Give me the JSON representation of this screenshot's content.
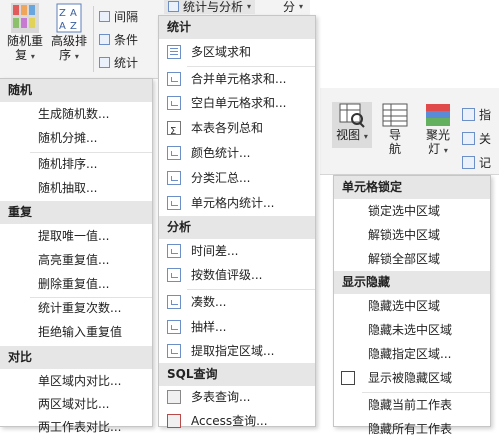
{
  "ribbon_left": {
    "random_repeat": {
      "line1": "随机重",
      "line2": "复",
      "caret": "▾"
    },
    "advanced_sort": {
      "line1": "高级排",
      "line2": "序",
      "caret": "▾"
    },
    "spacing": "间隔",
    "condition": "条件",
    "stats": "统计"
  },
  "ribbon_top": {
    "stats_analysis": "统计与分析",
    "caret": "▾",
    "split": "分"
  },
  "ribbon_right": {
    "view": "视图",
    "navigation": {
      "line1": "导",
      "line2": "航"
    },
    "spotlight": {
      "line1": "聚光",
      "line2": "灯"
    },
    "finger": "指",
    "close": "关",
    "record": "记",
    "caret": "▾"
  },
  "menu_left": {
    "sections": [
      {
        "header": "随机",
        "items": [
          "生成随机数...",
          "随机分摊...",
          "随机排序...",
          "随机抽取..."
        ]
      },
      {
        "header": "重复",
        "items": [
          "提取唯一值...",
          "高亮重复值...",
          "删除重复值...",
          "统计重复次数...",
          "拒绝输入重复值"
        ]
      },
      {
        "header": "对比",
        "items": [
          "单区域内对比...",
          "两区域对比...",
          "两工作表对比..."
        ]
      }
    ]
  },
  "menu_middle": {
    "sections": [
      {
        "header": "统计",
        "items": [
          "多区域求和",
          "合并单元格求和...",
          "空白单元格求和...",
          "本表各列总和",
          "颜色统计...",
          "分类汇总...",
          "单元格内统计..."
        ]
      },
      {
        "header": "分析",
        "items": [
          "时间差...",
          "按数值评级...",
          "凑数...",
          "抽样...",
          "提取指定区域..."
        ]
      },
      {
        "header": "SQL查询",
        "items": [
          "多表查询...",
          "Access查询..."
        ]
      }
    ]
  },
  "menu_right": {
    "sections": [
      {
        "header": "单元格锁定",
        "items": [
          "锁定选中区域",
          "解锁选中区域",
          "解锁全部区域"
        ]
      },
      {
        "header": "显示隐藏",
        "items": [
          "隐藏选中区域",
          "隐藏未选中区域",
          "隐藏指定区域...",
          "显示被隐藏区域",
          "隐藏当前工作表",
          "隐藏所有工作表"
        ]
      }
    ]
  },
  "colors": {
    "accent": "#4472c4",
    "header_bg": "#e6e6e6",
    "ribbon_bg": "#f3f3f3"
  }
}
